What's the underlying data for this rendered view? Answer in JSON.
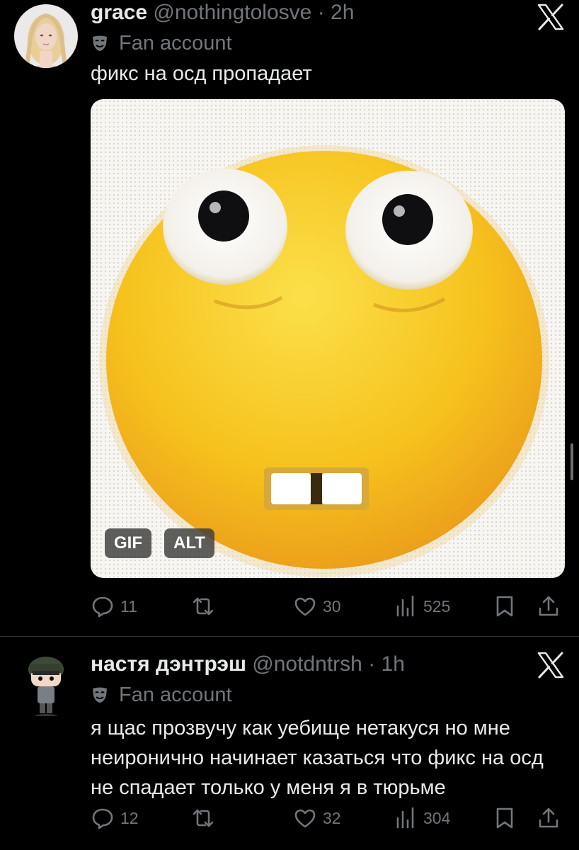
{
  "colors": {
    "background": "#000000",
    "text_primary": "#e7e9ea",
    "text_secondary": "#71767b",
    "divider": "#2f3336",
    "emoji_yellow": "#f6c21d"
  },
  "tweets": [
    {
      "display_name": "grace",
      "handle": "@nothingtolosve",
      "separator": "·",
      "time": "2h",
      "label": "Fan account",
      "label_icon": "mask-icon",
      "text": "фикс на осд пропадает",
      "avatar_icon": "user-photo-avatar",
      "media": {
        "type": "gif",
        "description_icon": "nervous-emoji",
        "badges": [
          "GIF",
          "ALT"
        ]
      },
      "stats": {
        "replies": "11",
        "reposts": "",
        "likes": "30",
        "views": "525"
      }
    },
    {
      "display_name": "настя дэнтрэш",
      "handle": "@notdntrsh",
      "separator": "·",
      "time": "1h",
      "label": "Fan account",
      "label_icon": "mask-icon",
      "text": "я щас прозвучу как уебище нетакуся но мне неиронично начинает казаться что фикс на осд не спадает только у меня я в тюрьме",
      "avatar_icon": "funko-figure-avatar",
      "stats": {
        "replies": "12",
        "reposts": "",
        "likes": "32",
        "views": "304"
      }
    }
  ]
}
